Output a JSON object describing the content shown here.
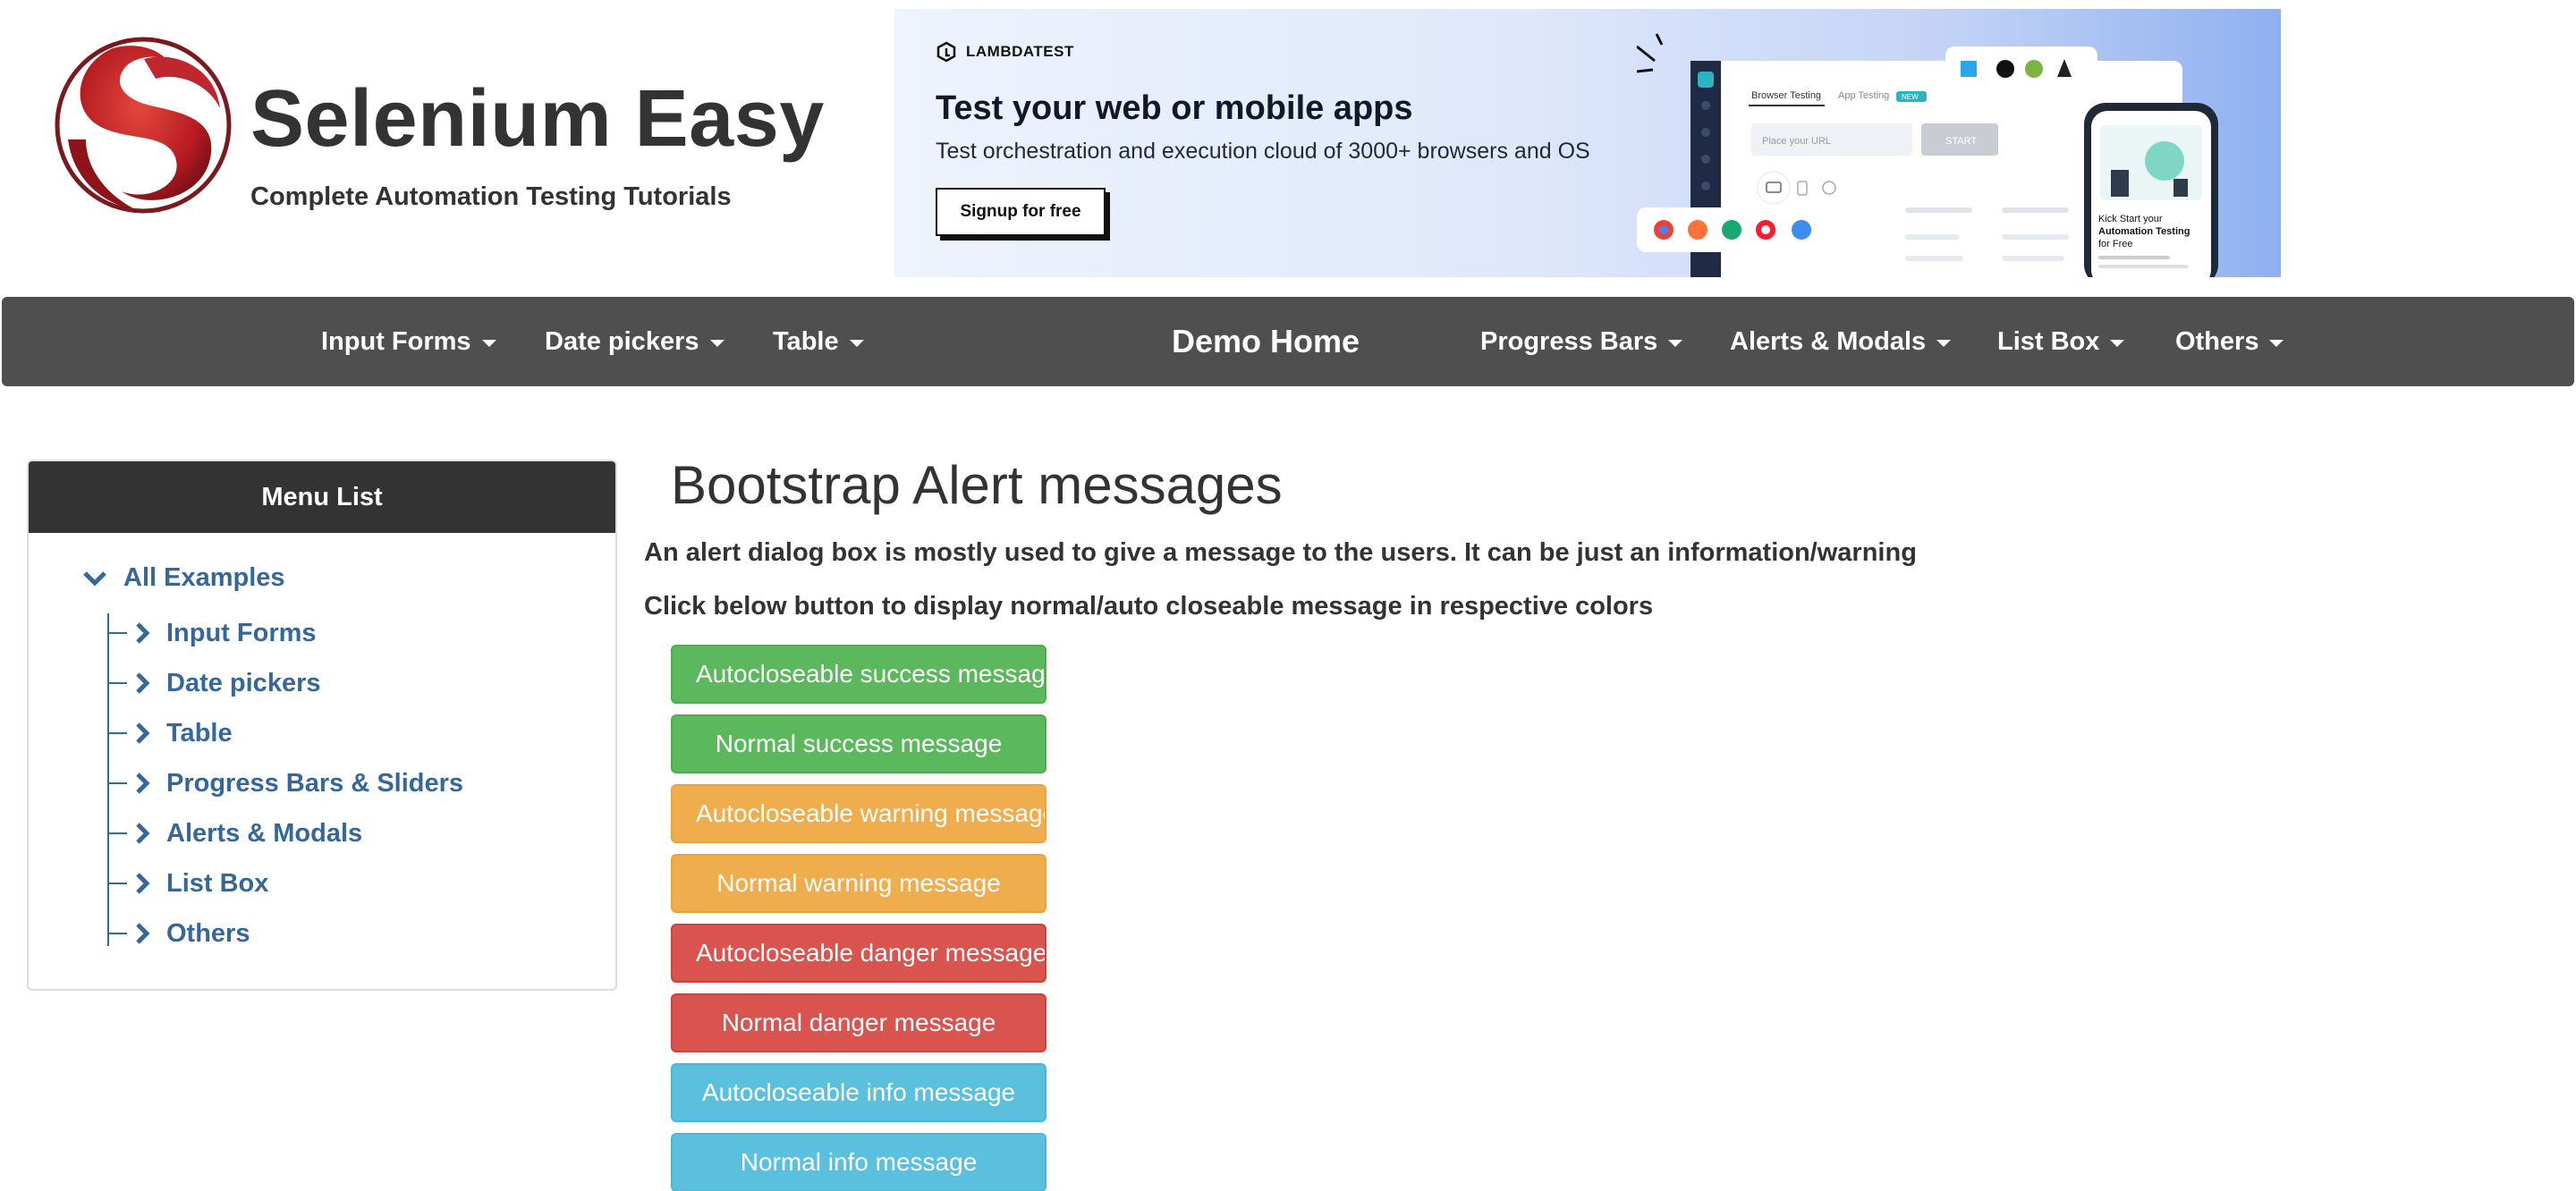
{
  "header": {
    "site_title": "Selenium Easy",
    "tagline": "Complete Automation Testing Tutorials"
  },
  "ad": {
    "brand": "LAMBDATEST",
    "headline": "Test your web or mobile apps",
    "subtext": "Test orchestration and execution cloud of 3000+ browsers and OS",
    "cta": "Signup for free",
    "mock_tab_browser": "Browser Testing",
    "mock_tab_app": "App Testing",
    "mock_badge": "NEW",
    "mock_url_placeholder": "Place your URL",
    "mock_start": "START",
    "phone_line1": "Kick Start your",
    "phone_line2": "Automation Testing",
    "phone_line3": "for Free"
  },
  "navbar": {
    "items_left": [
      "Input Forms",
      "Date pickers",
      "Table"
    ],
    "home": "Demo Home",
    "items_right": [
      "Progress Bars",
      "Alerts & Modals",
      "List Box",
      "Others"
    ]
  },
  "sidebar": {
    "title": "Menu List",
    "root": "All Examples",
    "items": [
      "Input Forms",
      "Date pickers",
      "Table",
      "Progress Bars & Sliders",
      "Alerts & Modals",
      "List Box",
      "Others"
    ]
  },
  "main": {
    "title": "Bootstrap Alert messages",
    "description": "An alert dialog box is mostly used to give a message to the users. It can be just an information/warning",
    "instruction": "Click below button to display normal/auto closeable message in respective colors",
    "buttons": [
      "Autocloseable success message",
      "Normal success message",
      "Autocloseable warning message",
      "Normal warning message",
      "Autocloseable danger message",
      "Normal danger message",
      "Autocloseable info message",
      "Normal info message"
    ]
  },
  "colors": {
    "navbar": "#4f4f4f",
    "sidebar_header": "#333333",
    "link": "#35679b",
    "success": "#5cb85c",
    "warning": "#f0ad4e",
    "danger": "#d9534f",
    "info": "#5bc0de",
    "logo_red": "#c0262d"
  }
}
